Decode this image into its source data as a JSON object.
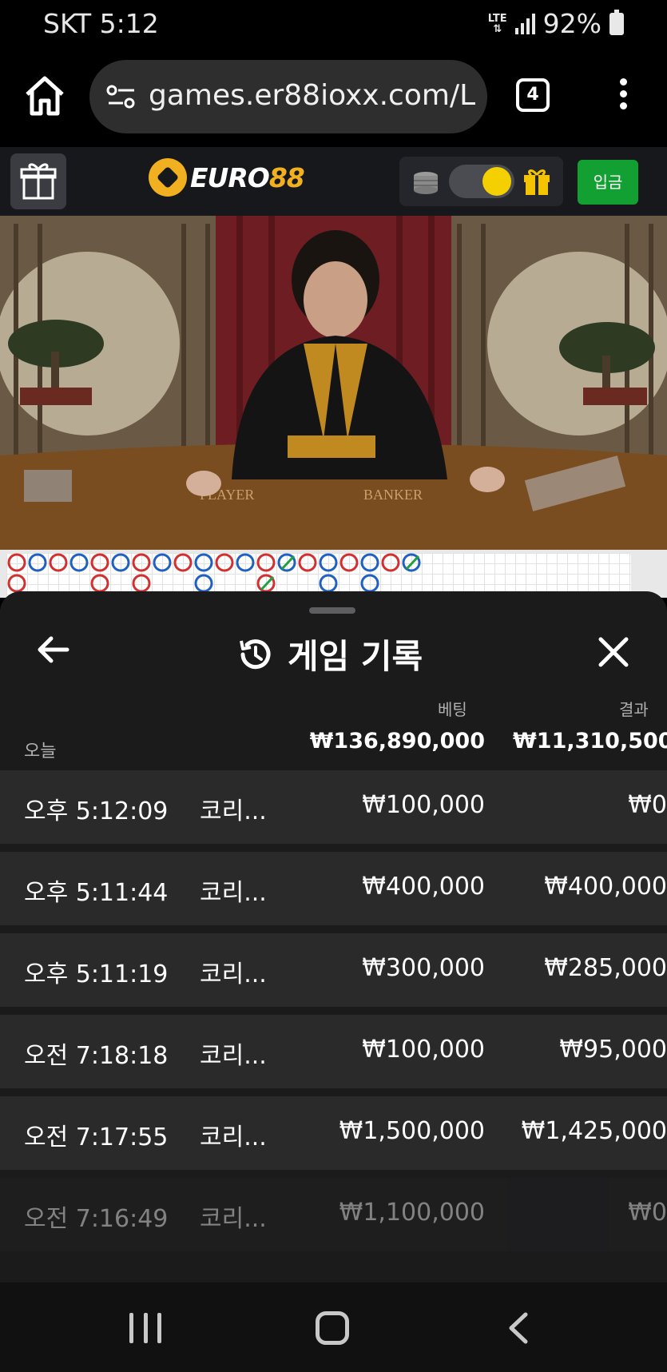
{
  "status_bar": {
    "carrier_time": "SKT 5:12",
    "network": "LTE",
    "battery": "92%"
  },
  "browser": {
    "url": "games.er88ioxx.com/L",
    "tab_count": "4"
  },
  "site": {
    "logo_text_a": "EURO",
    "logo_text_b": "88",
    "deposit_label": "입금",
    "accent": "#f0b020",
    "deposit_color": "#12a032"
  },
  "video": {
    "table_label_player": "PLAYER",
    "table_label_banker": "BANKER"
  },
  "history": {
    "title": "게임 기록",
    "col_bet": "베팅",
    "col_result": "결과",
    "today_label": "오늘",
    "total_bet": "₩136,890,000",
    "total_result": "₩11,310,500",
    "rows": [
      {
        "time": "오후 5:12:09",
        "game": "코리...",
        "bet": "₩100,000",
        "result": "₩0"
      },
      {
        "time": "오후 5:11:44",
        "game": "코리...",
        "bet": "₩400,000",
        "result": "₩400,000"
      },
      {
        "time": "오후 5:11:19",
        "game": "코리...",
        "bet": "₩300,000",
        "result": "₩285,000"
      },
      {
        "time": "오전 7:18:18",
        "game": "코리...",
        "bet": "₩100,000",
        "result": "₩95,000"
      },
      {
        "time": "오전 7:17:55",
        "game": "코리...",
        "bet": "₩1,500,000",
        "result": "₩1,425,000"
      },
      {
        "time": "오전 7:16:49",
        "game": "코리...",
        "bet": "₩1,100,000",
        "result": "₩0"
      }
    ]
  }
}
